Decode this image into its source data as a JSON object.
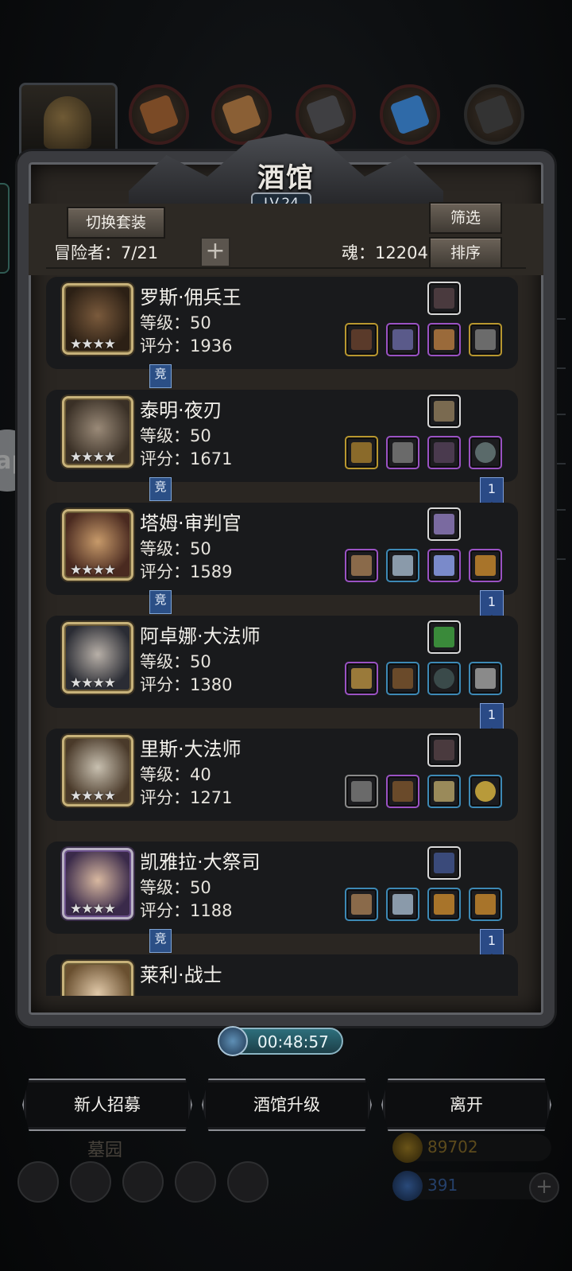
{
  "window": {
    "title": "酒馆",
    "level": "LV.24"
  },
  "header": {
    "switch_set_label": "切换套装",
    "filter_label": "筛选",
    "sort_label": "排序",
    "adventurers_label": "冒险者：7/21",
    "add_label": "+",
    "soul_label": "魂：12204"
  },
  "heroes": [
    {
      "name": "罗斯·佣兵王",
      "level": "等级：50",
      "score": "评分：1936",
      "stars": "★★★★",
      "arena": "竞",
      "ribbon": ""
    },
    {
      "name": "泰明·夜刃",
      "level": "等级：50",
      "score": "评分：1671",
      "stars": "★★★★",
      "arena": "竞",
      "ribbon": "1"
    },
    {
      "name": "塔姆·审判官",
      "level": "等级：50",
      "score": "评分：1589",
      "stars": "★★★★",
      "arena": "竞",
      "ribbon": "1"
    },
    {
      "name": "阿卓娜·大法师",
      "level": "等级：50",
      "score": "评分：1380",
      "stars": "★★★★",
      "arena": "",
      "ribbon": "1"
    },
    {
      "name": "里斯·大法师",
      "level": "等级：40",
      "score": "评分：1271",
      "stars": "★★★★",
      "arena": "",
      "ribbon": ""
    },
    {
      "name": "凯雅拉·大祭司",
      "level": "等级：50",
      "score": "评分：1188",
      "stars": "★★★★",
      "arena": "竞",
      "ribbon": "1"
    },
    {
      "name": "莱利·战士",
      "level": "",
      "score": "",
      "stars": "",
      "arena": "",
      "ribbon": ""
    }
  ],
  "timer": {
    "value": "00:48:57"
  },
  "actions": {
    "recruit": "新人招募",
    "upgrade": "酒馆升级",
    "leave": "离开"
  },
  "background": {
    "area_label": "墓园",
    "gold": "89702",
    "gems": "391",
    "side_bubble": "ap"
  }
}
